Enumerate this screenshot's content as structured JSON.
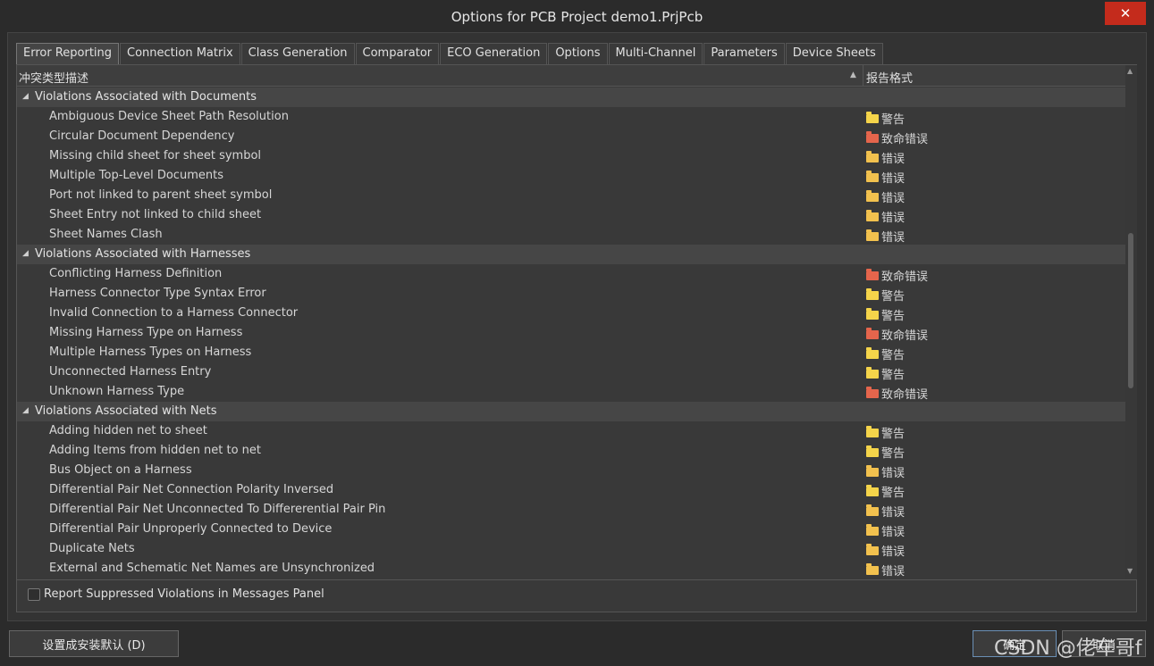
{
  "window": {
    "title": "Options for PCB Project demo1.PrjPcb",
    "close_glyph": "✕"
  },
  "tabs": [
    {
      "label": "Error Reporting"
    },
    {
      "label": "Connection Matrix"
    },
    {
      "label": "Class Generation"
    },
    {
      "label": "Comparator"
    },
    {
      "label": "ECO Generation"
    },
    {
      "label": "Options"
    },
    {
      "label": "Multi-Channel"
    },
    {
      "label": "Parameters"
    },
    {
      "label": "Device Sheets"
    }
  ],
  "grid": {
    "col_description": "冲突类型描述",
    "col_report_mode": "报告格式",
    "sort_glyph": "▲"
  },
  "levels": {
    "warning": {
      "label": "警告",
      "color": "#f5d44a"
    },
    "error": {
      "label": "错误",
      "color": "#f2c14e"
    },
    "fatal": {
      "label": "致命错误",
      "color": "#e5654c"
    }
  },
  "groups": [
    {
      "name": "Violations Associated with Documents",
      "items": [
        {
          "label": "Ambiguous Device Sheet Path Resolution",
          "level": "警告",
          "color": "#f5d44a"
        },
        {
          "label": "Circular Document Dependency",
          "level": "致命错误",
          "color": "#e5654c"
        },
        {
          "label": "Missing child sheet for sheet symbol",
          "level": "错误",
          "color": "#f2c14e"
        },
        {
          "label": "Multiple Top-Level Documents",
          "level": "错误",
          "color": "#f2c14e"
        },
        {
          "label": "Port not linked to parent sheet symbol",
          "level": "错误",
          "color": "#f2c14e"
        },
        {
          "label": "Sheet Entry not linked to child sheet",
          "level": "错误",
          "color": "#f2c14e"
        },
        {
          "label": "Sheet Names Clash",
          "level": "错误",
          "color": "#f2c14e"
        }
      ]
    },
    {
      "name": "Violations Associated with Harnesses",
      "items": [
        {
          "label": "Conflicting Harness Definition",
          "level": "致命错误",
          "color": "#e5654c"
        },
        {
          "label": "Harness Connector Type Syntax Error",
          "level": "警告",
          "color": "#f5d44a"
        },
        {
          "label": "Invalid Connection to a Harness Connector",
          "level": "警告",
          "color": "#f5d44a"
        },
        {
          "label": "Missing Harness Type on Harness",
          "level": "致命错误",
          "color": "#e5654c"
        },
        {
          "label": "Multiple Harness Types on Harness",
          "level": "警告",
          "color": "#f5d44a"
        },
        {
          "label": "Unconnected Harness Entry",
          "level": "警告",
          "color": "#f5d44a"
        },
        {
          "label": "Unknown Harness Type",
          "level": "致命错误",
          "color": "#e5654c"
        }
      ]
    },
    {
      "name": "Violations Associated with Nets",
      "items": [
        {
          "label": "Adding hidden net to sheet",
          "level": "警告",
          "color": "#f5d44a"
        },
        {
          "label": "Adding Items from hidden net to net",
          "level": "警告",
          "color": "#f5d44a"
        },
        {
          "label": "Bus Object on a Harness",
          "level": "错误",
          "color": "#f2c14e"
        },
        {
          "label": "Differential Pair Net Connection Polarity Inversed",
          "level": "警告",
          "color": "#f5d44a"
        },
        {
          "label": "Differential Pair Net Unconnected To Differerential Pair Pin",
          "level": "错误",
          "color": "#f2c14e"
        },
        {
          "label": "Differential Pair Unproperly Connected to Device",
          "level": "错误",
          "color": "#f2c14e"
        },
        {
          "label": "Duplicate Nets",
          "level": "错误",
          "color": "#f2c14e"
        },
        {
          "label": "External and Schematic Net Names are Unsynchronized",
          "level": "错误",
          "color": "#f2c14e"
        }
      ]
    }
  ],
  "options": {
    "report_suppressed_label": "Report Suppressed Violations in Messages Panel",
    "report_suppressed_checked": false
  },
  "buttons": {
    "set_default": "设置成安装默认 (D)",
    "ok": "确定",
    "cancel": "取消"
  },
  "watermark": "CSDN @佬车哥f"
}
